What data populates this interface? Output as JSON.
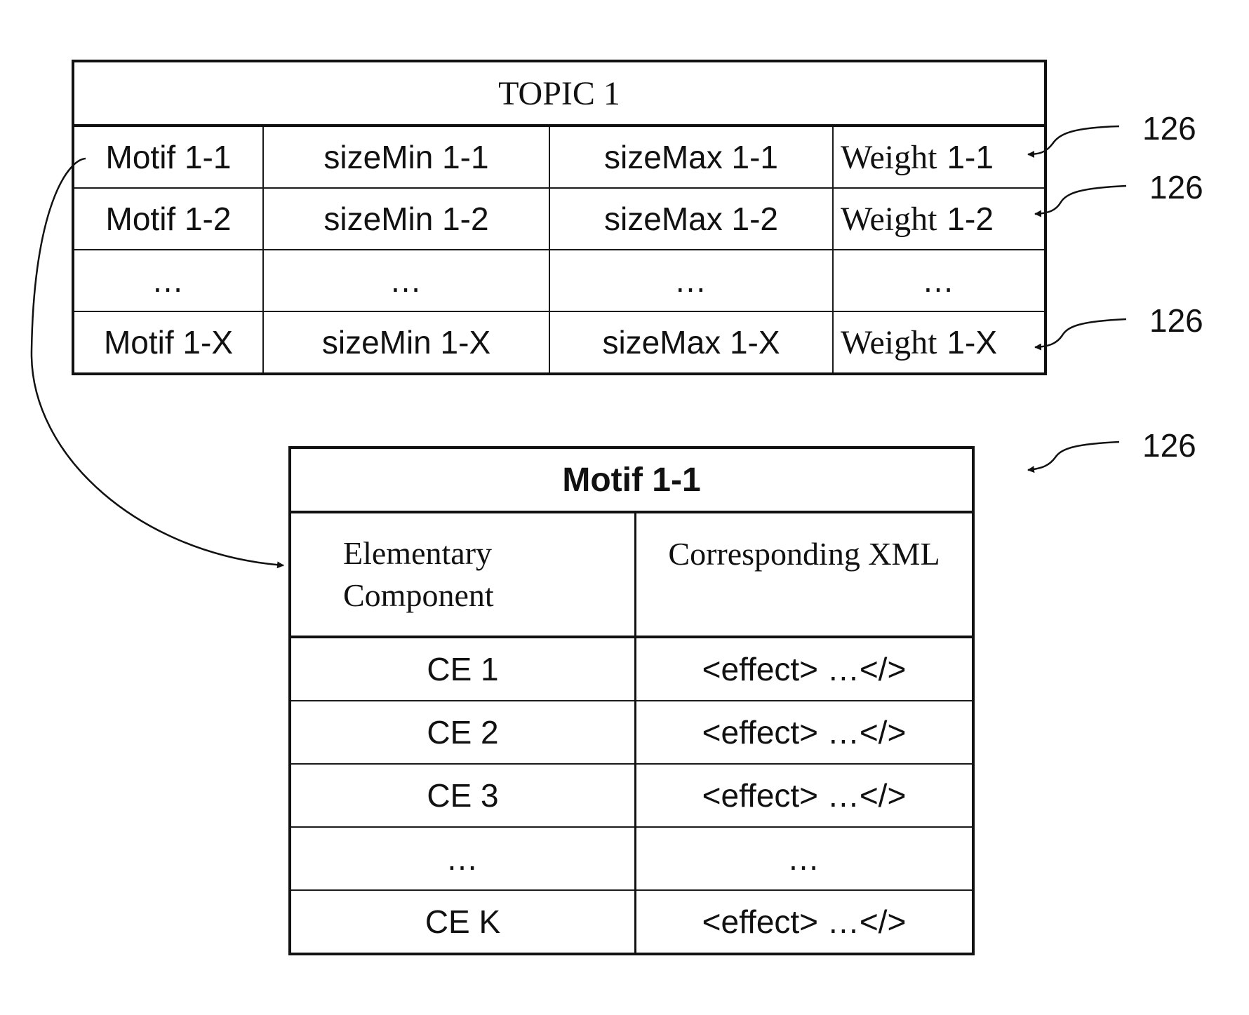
{
  "topic_table": {
    "title": "TOPIC 1",
    "rows": [
      {
        "motif": "Motif 1-1",
        "size_min": "sizeMin 1-1",
        "size_max": "sizeMax 1-1",
        "weight_label": "Weight",
        "weight_id": "1-1"
      },
      {
        "motif": "Motif 1-2",
        "size_min": "sizeMin 1-2",
        "size_max": "sizeMax 1-2",
        "weight_label": "Weight",
        "weight_id": "1-2"
      },
      {
        "motif": "…",
        "size_min": "…",
        "size_max": "...",
        "weight_label": "…",
        "weight_id": ""
      },
      {
        "motif": "Motif 1-X",
        "size_min": "sizeMin 1-X",
        "size_max": "sizeMax 1-X",
        "weight_label": "Weight",
        "weight_id": "1-X"
      }
    ]
  },
  "motif_table": {
    "title": "Motif 1-1",
    "headers": {
      "col1_line1": "Elementary",
      "col1_line2": "Component",
      "col2": "Corresponding XML"
    },
    "rows": [
      {
        "component": "CE 1",
        "xml": "<effect> …</>"
      },
      {
        "component": "CE 2",
        "xml": "<effect> …</>"
      },
      {
        "component": "CE 3",
        "xml": "<effect> …</>"
      },
      {
        "component": "…",
        "xml": "…"
      },
      {
        "component": "CE K",
        "xml": "<effect> …</>"
      }
    ]
  },
  "reference_labels": [
    "126",
    "126",
    "126",
    "126"
  ]
}
